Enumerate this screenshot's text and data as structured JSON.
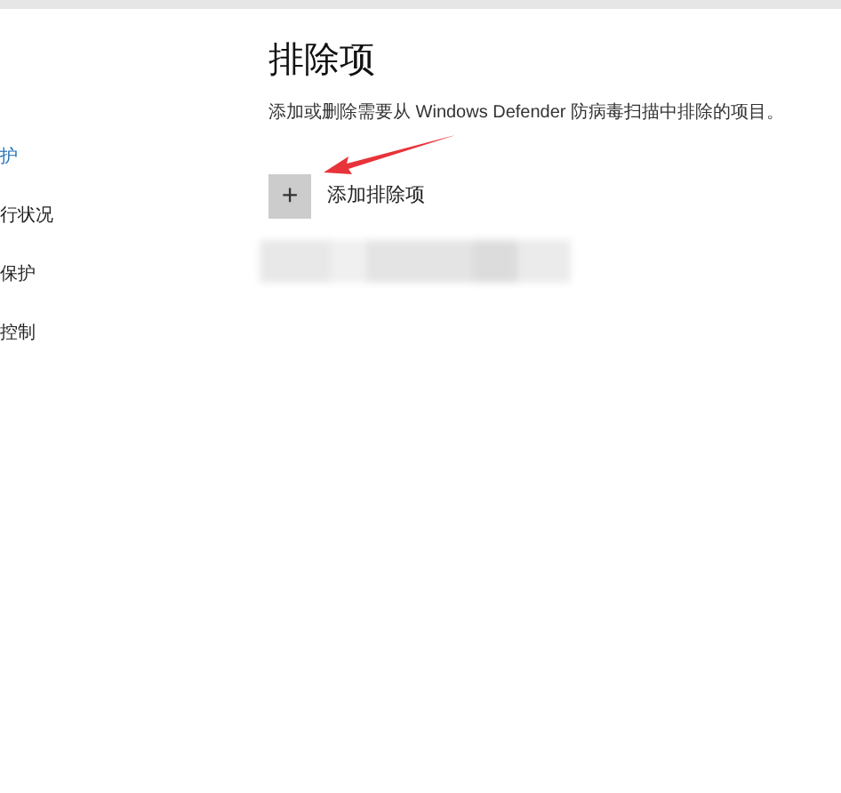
{
  "sidebar": {
    "items": [
      {
        "label": "护",
        "selected": true
      },
      {
        "label": "行状况",
        "selected": false
      },
      {
        "label": "保护",
        "selected": false
      },
      {
        "label": "控制",
        "selected": false
      }
    ]
  },
  "page": {
    "title": "排除项",
    "description": "添加或删除需要从 Windows Defender 防病毒扫描中排除的项目。",
    "add_button": {
      "icon": "+",
      "label": "添加排除项"
    }
  }
}
